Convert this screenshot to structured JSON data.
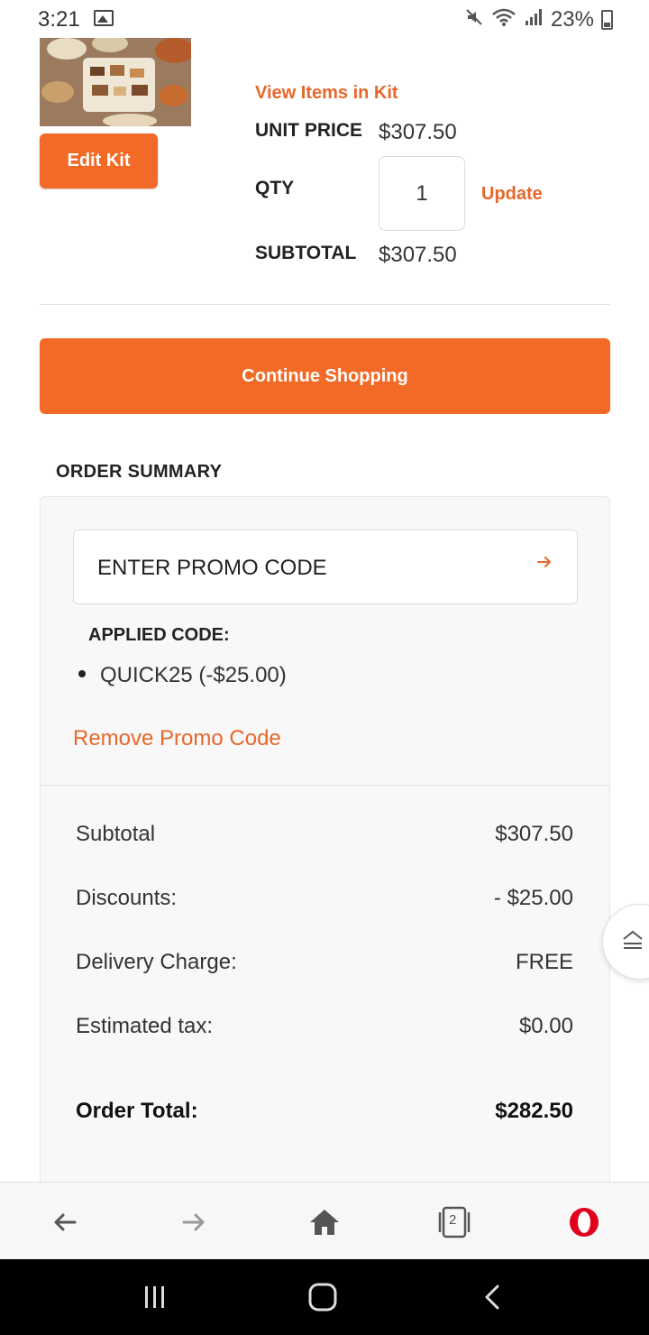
{
  "status_bar": {
    "time": "3:21",
    "battery": "23%",
    "icons": [
      "image-icon",
      "mute-icon",
      "wifi-icon",
      "signal-icon",
      "battery-icon"
    ]
  },
  "product": {
    "cut_off_text": "",
    "view_items_label": "View Items in Kit",
    "edit_kit_label": "Edit Kit",
    "unit_price_label": "UNIT PRICE",
    "unit_price_value": "$307.50",
    "qty_label": "QTY",
    "qty_value": "1",
    "update_label": "Update",
    "subtotal_label": "SUBTOTAL",
    "subtotal_value": "$307.50"
  },
  "continue_shopping_label": "Continue Shopping",
  "order_summary": {
    "heading": "ORDER SUMMARY",
    "promo_placeholder": "ENTER PROMO CODE",
    "applied_code_label": "APPLIED CODE:",
    "applied_codes": [
      "QUICK25 (-$25.00)"
    ],
    "remove_promo_label": "Remove Promo Code",
    "rows": [
      {
        "label": "Subtotal",
        "value": "$307.50"
      },
      {
        "label": "Discounts:",
        "value": "- $25.00"
      },
      {
        "label": "Delivery Charge:",
        "value": "FREE"
      },
      {
        "label": "Estimated tax:",
        "value": "$0.00"
      }
    ],
    "total_label": "Order Total:",
    "total_value": "$282.50"
  },
  "browser_bar": {
    "tab_count": "2"
  },
  "colors": {
    "accent": "#f26a26",
    "link": "#e8672b",
    "opera_red": "#e0001b"
  }
}
